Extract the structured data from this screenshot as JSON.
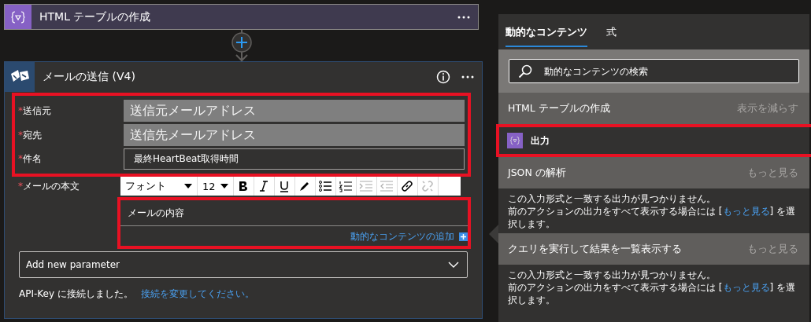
{
  "html_step": {
    "title": "HTML テーブルの作成"
  },
  "mail_step": {
    "title": "メールの送信 (V4)",
    "fields_highlighted": true,
    "fields": [
      {
        "label": "送信元",
        "required_mark": "*",
        "kind": "filled",
        "value": "送信元メールアドレス"
      },
      {
        "label": "宛先",
        "required_mark": "*",
        "kind": "filled",
        "value": "送信先メールアドレス"
      },
      {
        "label": "件名",
        "required_mark": "*",
        "kind": "text",
        "value": "最終HeartBeat取得時間"
      }
    ],
    "body": {
      "label": "メールの本文",
      "required_mark": "*",
      "font": "フォント",
      "size": "12",
      "value": "メールの内容",
      "dynamic_link": "動的なコンテンツの追加",
      "highlighted": true
    },
    "add_parameter": "Add new parameter",
    "connection": {
      "text": "API-Key に接続しました。",
      "link": "接続を変更してください。"
    }
  },
  "panel": {
    "tabs": [
      {
        "label": "動的なコンテンツ",
        "selected": true
      },
      {
        "label": "式",
        "selected": false
      }
    ],
    "search": {
      "placeholder": "動的なコンテンツの検索"
    },
    "sections": [
      {
        "title": "HTML テーブルの作成",
        "action": "表示を減らす",
        "items": [
          {
            "label": "出力",
            "highlighted": true
          }
        ]
      },
      {
        "title": "JSON の解析",
        "action": "もっと見る",
        "message": {
          "line1": "この入力形式と一致する出力が見つかりません。",
          "before": "前のアクションの出力をすべて表示する場合には [",
          "link": "もっと見る",
          "after": "] を選択します。"
        }
      },
      {
        "title": "クエリを実行して結果を一覧表示する",
        "action": "もっと見る",
        "message": {
          "line1": "この入力形式と一致する出力が見つかりません。",
          "before": "前のアクションの出力をすべて表示する場合には [",
          "link": "もっと見る",
          "after": "] を選択します。"
        }
      }
    ]
  }
}
